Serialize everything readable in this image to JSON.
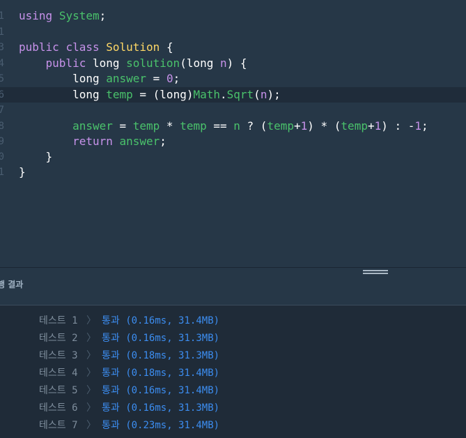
{
  "editor": {
    "lines": [
      {
        "number": "1",
        "tokens": [
          [
            "kw",
            "using"
          ],
          [
            "pl",
            " "
          ],
          [
            "nm",
            "System"
          ],
          [
            "pl",
            ";"
          ]
        ]
      },
      {
        "number": "1",
        "tokens": []
      },
      {
        "number": "3",
        "tokens": [
          [
            "kw",
            "public"
          ],
          [
            "pl",
            " "
          ],
          [
            "kw",
            "class"
          ],
          [
            "pl",
            " "
          ],
          [
            "cls",
            "Solution"
          ],
          [
            "pl",
            " {"
          ]
        ]
      },
      {
        "number": "4",
        "tokens": [
          [
            "pl",
            "    "
          ],
          [
            "kw",
            "public"
          ],
          [
            "pl",
            " long "
          ],
          [
            "nm",
            "solution"
          ],
          [
            "pl",
            "(long "
          ],
          [
            "pa",
            "n"
          ],
          [
            "pl",
            ") {"
          ]
        ]
      },
      {
        "number": "5",
        "tokens": [
          [
            "pl",
            "        long "
          ],
          [
            "nm",
            "answer"
          ],
          [
            "pl",
            " = "
          ],
          [
            "num",
            "0"
          ],
          [
            "pl",
            ";"
          ]
        ]
      },
      {
        "number": "6",
        "tokens": [
          [
            "pl",
            "        long "
          ],
          [
            "nm",
            "temp"
          ],
          [
            "pl",
            " = (long)"
          ],
          [
            "nm",
            "Math"
          ],
          [
            "pl",
            "."
          ],
          [
            "nm",
            "Sqrt"
          ],
          [
            "pl",
            "("
          ],
          [
            "pa",
            "n"
          ],
          [
            "pl",
            ");"
          ]
        ]
      },
      {
        "number": "7",
        "tokens": []
      },
      {
        "number": "8",
        "tokens": [
          [
            "pl",
            "        "
          ],
          [
            "nm",
            "answer"
          ],
          [
            "pl",
            " = "
          ],
          [
            "nm",
            "temp"
          ],
          [
            "pl",
            " * "
          ],
          [
            "nm",
            "temp"
          ],
          [
            "pl",
            " == "
          ],
          [
            "nm",
            "n"
          ],
          [
            "pl",
            " ? ("
          ],
          [
            "nm",
            "temp"
          ],
          [
            "pl",
            "+"
          ],
          [
            "num",
            "1"
          ],
          [
            "pl",
            ") * ("
          ],
          [
            "nm",
            "temp"
          ],
          [
            "pl",
            "+"
          ],
          [
            "num",
            "1"
          ],
          [
            "pl",
            ") : -"
          ],
          [
            "num",
            "1"
          ],
          [
            "pl",
            ";"
          ]
        ]
      },
      {
        "number": "9",
        "tokens": [
          [
            "pl",
            "        "
          ],
          [
            "kw",
            "return"
          ],
          [
            "pl",
            " "
          ],
          [
            "nm",
            "answer"
          ],
          [
            "pl",
            ";"
          ]
        ]
      },
      {
        "number": "0",
        "tokens": [
          [
            "pl",
            "    }"
          ]
        ]
      },
      {
        "number": "1",
        "tokens": [
          [
            "pl",
            "}"
          ]
        ]
      }
    ],
    "active_line_index": 5
  },
  "results": {
    "title": "행 결과",
    "rows": [
      {
        "label": "테스트 1",
        "chevron": "〉",
        "result": "통과 (0.16ms, 31.4MB)"
      },
      {
        "label": "테스트 2",
        "chevron": "〉",
        "result": "통과 (0.16ms, 31.3MB)"
      },
      {
        "label": "테스트 3",
        "chevron": "〉",
        "result": "통과 (0.18ms, 31.3MB)"
      },
      {
        "label": "테스트 4",
        "chevron": "〉",
        "result": "통과 (0.18ms, 31.4MB)"
      },
      {
        "label": "테스트 5",
        "chevron": "〉",
        "result": "통과 (0.16ms, 31.4MB)"
      },
      {
        "label": "테스트 6",
        "chevron": "〉",
        "result": "통과 (0.16ms, 31.3MB)"
      },
      {
        "label": "테스트 7",
        "chevron": "〉",
        "result": "통과 (0.23ms, 31.4MB)"
      }
    ]
  },
  "colors": {
    "background": "#263747",
    "results_background": "#1f2b38",
    "keyword": "#c792ea",
    "identifier": "#4ac26b",
    "class_name": "#ffd866",
    "pass": "#3c8df0",
    "label": "#7e8d9c"
  }
}
